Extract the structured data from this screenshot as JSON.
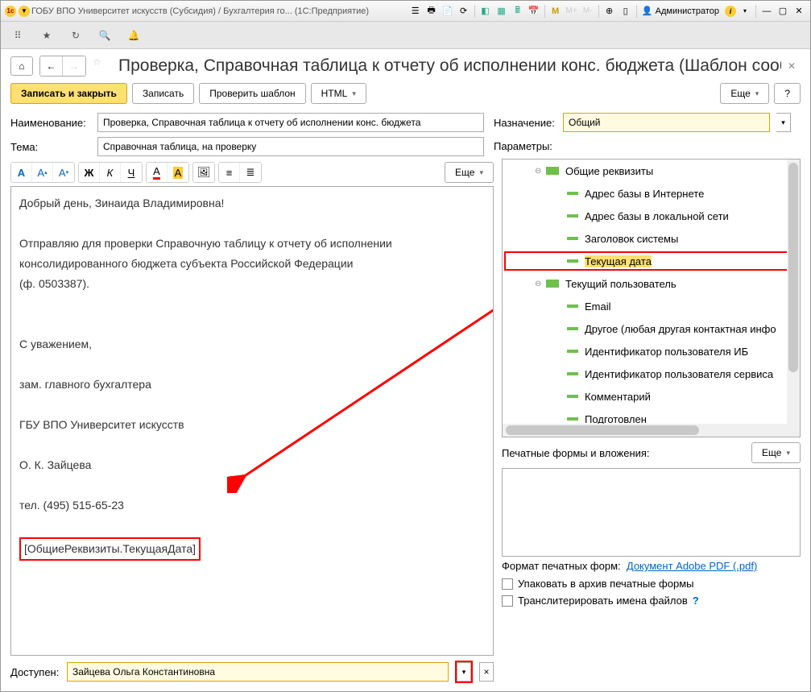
{
  "titlebar": {
    "text": "ГОБУ ВПО Университет искусств (Субсидия) / Бухгалтерия го...  (1С:Предприятие)",
    "user": "Администратор",
    "m1": "M",
    "m2": "M+",
    "m3": "M-"
  },
  "page": {
    "title": "Проверка, Справочная таблица к отчету об исполнении конс. бюджета (Шаблон сообщ..."
  },
  "toolbar": {
    "save_close": "Записать и закрыть",
    "save": "Записать",
    "check_template": "Проверить шаблон",
    "html": "HTML",
    "more": "Еще",
    "help": "?"
  },
  "form": {
    "name_label": "Наименование:",
    "name_value": "Проверка, Справочная таблица к отчету об исполнении конс. бюджета",
    "subject_label": "Тема:",
    "subject_value": "Справочная таблица, на проверку",
    "dest_label": "Назначение:",
    "dest_value": "Общий",
    "params_label": "Параметры:"
  },
  "editor": {
    "more": "Еще",
    "bold": "Ж",
    "italic": "К",
    "underline": "Ч",
    "greeting": "Добрый день, Зинаида Владимировна!",
    "body1": "Отправляю для проверки Справочную таблицу к отчету об исполнении",
    "body2": " консолидированного бюджета субъекта Российской Федерации",
    "body3": "(ф. 0503387).",
    "regards": "С уважением,",
    "sign1": "зам. главного бухгалтера",
    "sign2": "ГБУ ВПО Университет искусств",
    "sign3": "О. К. Зайцева",
    "sign4": "тел. (495) 515-65-23",
    "placeholder": "[ОбщиеРеквизиты.ТекущаяДата]"
  },
  "available": {
    "label": "Доступен:",
    "value": "Зайцева Ольга Константиновна"
  },
  "tree": {
    "root1": "Общие реквизиты",
    "items1": [
      "Адрес базы в Интернете",
      "Адрес базы в локальной сети",
      "Заголовок системы",
      "Текущая дата"
    ],
    "root2": "Текущий пользователь",
    "items2": [
      "Email",
      "Другое (любая другая контактная инфо",
      "Идентификатор пользователя ИБ",
      "Идентификатор пользователя сервиса",
      "Комментарий",
      "Подготовлен"
    ]
  },
  "printforms": {
    "label": "Печатные формы и вложения:",
    "more": "Еще",
    "format_label": "Формат печатных форм:",
    "format_link": "Документ Adobe PDF (.pdf)",
    "pack": "Упаковать в архив печатные формы",
    "translit": "Транслитерировать имена файлов"
  }
}
